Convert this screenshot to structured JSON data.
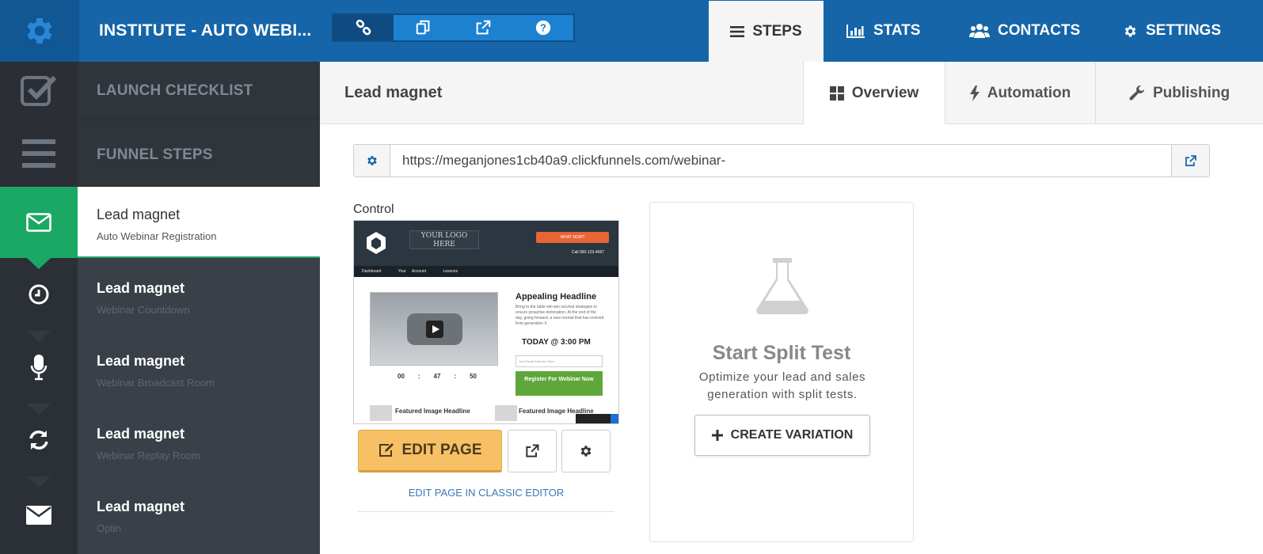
{
  "topbar": {
    "title": "INSTITUTE - AUTO WEBI...",
    "tools": [
      {
        "icon": "link-icon"
      },
      {
        "icon": "copy-icon"
      },
      {
        "icon": "external-link-icon"
      },
      {
        "icon": "question-circle-icon"
      }
    ],
    "nav": [
      {
        "label": "STEPS",
        "icon": "bars-icon",
        "active": true
      },
      {
        "label": "STATS",
        "icon": "bar-chart-icon"
      },
      {
        "label": "CONTACTS",
        "icon": "users-icon"
      },
      {
        "label": "SETTINGS",
        "icon": "gear-icon"
      }
    ]
  },
  "sidebar": {
    "sections": [
      {
        "label": "LAUNCH CHECKLIST",
        "icon": "checkbox-icon"
      },
      {
        "label": "FUNNEL STEPS",
        "icon": "bars-icon"
      }
    ],
    "steps": [
      {
        "title": "Lead magnet",
        "subtitle": "Auto Webinar Registration",
        "icon": "envelope-outline-icon",
        "active": true
      },
      {
        "title": "Lead magnet",
        "subtitle": "Webinar Countdown",
        "icon": "clock-icon"
      },
      {
        "title": "Lead magnet",
        "subtitle": "Webinar Broadcast Room",
        "icon": "microphone-icon"
      },
      {
        "title": "Lead magnet",
        "subtitle": "Webinar Replay Room",
        "icon": "refresh-icon"
      },
      {
        "title": "Lead magnet",
        "subtitle": "Optin",
        "icon": "envelope-icon"
      }
    ]
  },
  "main": {
    "page_title": "Lead magnet",
    "tabs": [
      {
        "label": "Overview",
        "icon": "grid-icon",
        "active": true
      },
      {
        "label": "Automation",
        "icon": "bolt-icon"
      },
      {
        "label": "Publishing",
        "icon": "wrench-icon"
      }
    ],
    "url": "https://meganjones1cb40a9.clickfunnels.com/webinar-",
    "control_label": "Control",
    "thumbnail": {
      "logo_text": "YOUR LOGO HERE",
      "button_text": "WHAT NOW?",
      "call_text": "Call 000-123-4567",
      "nav": [
        "Dashboard",
        "Your Account",
        "Lessons"
      ],
      "headline": "Appealing Headline",
      "body": "Bring to the table win-win survival strategies to ensure proactive domination. At the end of the day, going forward, a new normal that has evolved from generation X",
      "today": "TODAY @ 3:00 PM",
      "email_placeholder": "Your Email Address Here...",
      "register_label": "Register For Webinar Now",
      "timer": [
        "00",
        ":",
        "47",
        ":",
        "50"
      ],
      "featured_headline": "Featured Image Headline"
    },
    "edit_page_label": "EDIT PAGE",
    "classic_editor_label": "EDIT PAGE IN CLASSIC EDITOR",
    "split_test": {
      "title": "Start Split Test",
      "description": "Optimize your lead and sales generation with split tests.",
      "button_label": "CREATE VARIATION"
    }
  },
  "colors": {
    "topbar": "#1565a8",
    "sidebar": "#3a4048",
    "active_step": "#1ba865",
    "edit_button": "#f8c065"
  }
}
